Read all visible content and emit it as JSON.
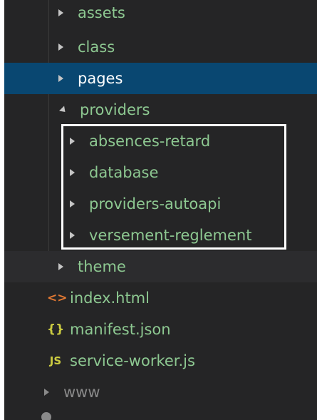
{
  "tree": {
    "items": [
      {
        "label": "assets",
        "kind": "folder",
        "state": "collapsed"
      },
      {
        "label": "class",
        "kind": "folder",
        "state": "collapsed"
      },
      {
        "label": "pages",
        "kind": "folder",
        "state": "collapsed",
        "selected": true
      },
      {
        "label": "providers",
        "kind": "folder",
        "state": "expanded"
      },
      {
        "label": "absences-retard",
        "kind": "folder",
        "state": "collapsed"
      },
      {
        "label": "database",
        "kind": "folder",
        "state": "collapsed"
      },
      {
        "label": "providers-autoapi",
        "kind": "folder",
        "state": "collapsed"
      },
      {
        "label": "versement-reglement",
        "kind": "folder",
        "state": "collapsed"
      },
      {
        "label": "theme",
        "kind": "folder",
        "state": "collapsed"
      },
      {
        "label": "index.html",
        "kind": "file",
        "icon": "html-icon"
      },
      {
        "label": "manifest.json",
        "kind": "file",
        "icon": "json-icon"
      },
      {
        "label": "service-worker.js",
        "kind": "file",
        "icon": "js-icon"
      },
      {
        "label": "www",
        "kind": "folder",
        "state": "collapsed",
        "dim": true
      }
    ],
    "icon_glyphs": {
      "html": "<>",
      "json": "{}",
      "js": "JS"
    }
  },
  "colors": {
    "background": "#252526",
    "selection": "#094771",
    "git_untracked_text": "#8dc891",
    "highlight_border": "#ffffff"
  }
}
